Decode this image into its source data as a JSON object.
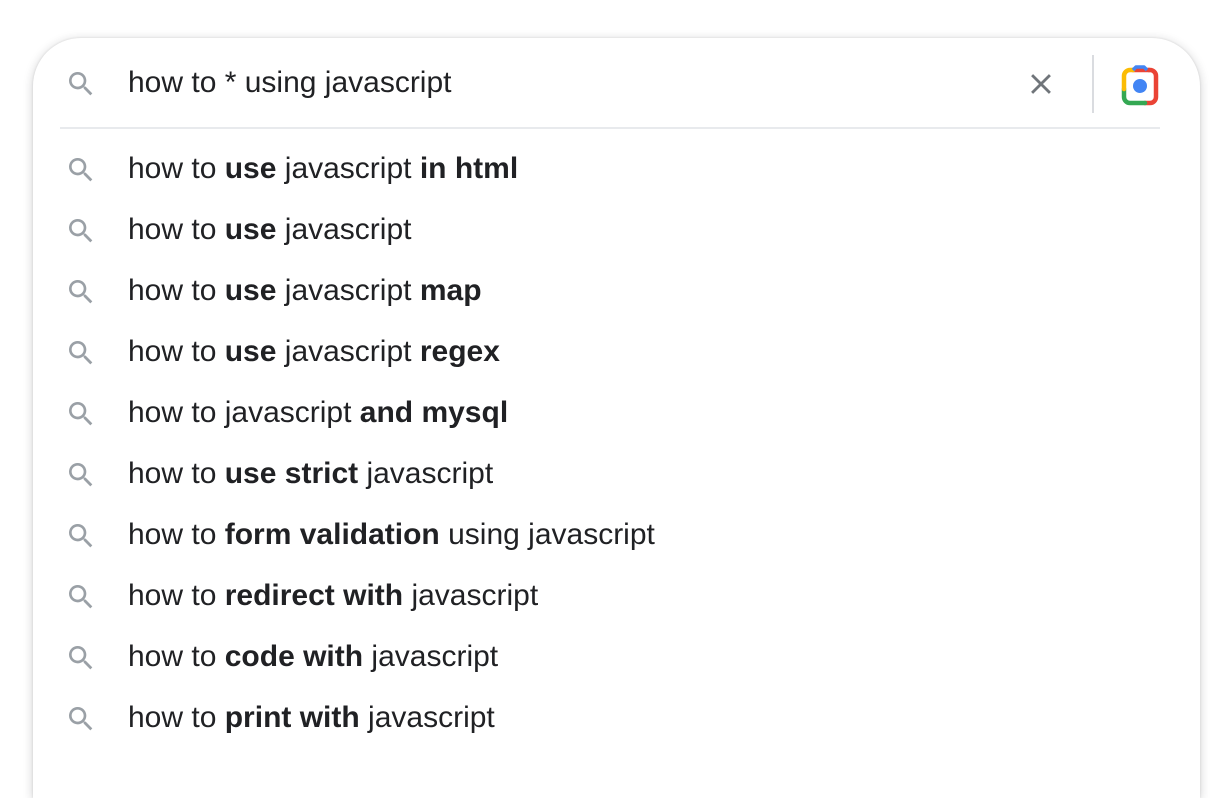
{
  "search": {
    "query": "how to * using javascript",
    "icon": "search-icon",
    "clear_icon": "close-icon",
    "camera_icon": "google-lens-icon"
  },
  "colors": {
    "text": "#202124",
    "icon_gray": "#9aa0a6",
    "clear_gray": "#70757a",
    "lens_blue": "#4285f4",
    "lens_red": "#ea4335",
    "lens_yellow": "#fbbc04",
    "lens_green": "#34a853"
  },
  "suggestions": [
    {
      "parts": [
        {
          "t": "how to ",
          "b": false
        },
        {
          "t": "use",
          "b": true
        },
        {
          "t": " javascript ",
          "b": false
        },
        {
          "t": "in html",
          "b": true
        }
      ]
    },
    {
      "parts": [
        {
          "t": "how to ",
          "b": false
        },
        {
          "t": "use",
          "b": true
        },
        {
          "t": " javascript",
          "b": false
        }
      ]
    },
    {
      "parts": [
        {
          "t": "how to ",
          "b": false
        },
        {
          "t": "use",
          "b": true
        },
        {
          "t": " javascript ",
          "b": false
        },
        {
          "t": "map",
          "b": true
        }
      ]
    },
    {
      "parts": [
        {
          "t": "how to ",
          "b": false
        },
        {
          "t": "use",
          "b": true
        },
        {
          "t": " javascript ",
          "b": false
        },
        {
          "t": "regex",
          "b": true
        }
      ]
    },
    {
      "parts": [
        {
          "t": "how to javascript ",
          "b": false
        },
        {
          "t": "and mysql",
          "b": true
        }
      ]
    },
    {
      "parts": [
        {
          "t": "how to ",
          "b": false
        },
        {
          "t": "use strict",
          "b": true
        },
        {
          "t": " javascript",
          "b": false
        }
      ]
    },
    {
      "parts": [
        {
          "t": "how to ",
          "b": false
        },
        {
          "t": "form validation",
          "b": true
        },
        {
          "t": " using javascript",
          "b": false
        }
      ]
    },
    {
      "parts": [
        {
          "t": "how to ",
          "b": false
        },
        {
          "t": "redirect with",
          "b": true
        },
        {
          "t": " javascript",
          "b": false
        }
      ]
    },
    {
      "parts": [
        {
          "t": "how to ",
          "b": false
        },
        {
          "t": "code with",
          "b": true
        },
        {
          "t": " javascript",
          "b": false
        }
      ]
    },
    {
      "parts": [
        {
          "t": "how to ",
          "b": false
        },
        {
          "t": "print with",
          "b": true
        },
        {
          "t": " javascript",
          "b": false
        }
      ]
    }
  ]
}
